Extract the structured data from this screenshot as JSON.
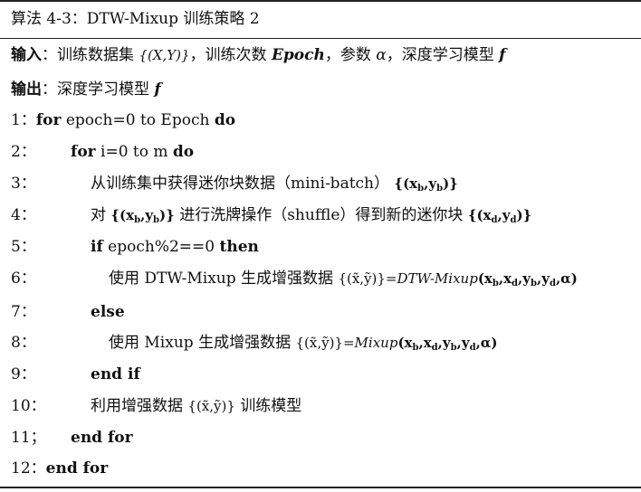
{
  "algorithm": {
    "title": "算法 4-3：DTW-Mixup 训练策略 2",
    "input": {
      "label": "输入",
      "colon": "：",
      "text1": "训练数据集",
      "dataset": "{(X,Y)}",
      "text2": "，训练次数",
      "epoch": "Epoch",
      "text3": "，参数",
      "alpha": "α",
      "text4": "，深度学习模型",
      "model": "f"
    },
    "output": {
      "label": "输出",
      "colon": "：",
      "text": "深度学习模型",
      "model": "f"
    },
    "lines": [
      {
        "num": "1：",
        "kw1": "for",
        "mid": " epoch=0 to Epoch ",
        "kw2": "do"
      },
      {
        "num": "2：",
        "kw1": "for",
        "mid": " i=0 to m ",
        "kw2": "do"
      },
      {
        "num": "3：",
        "text": "从训练集中获得迷你块数据（mini-batch）",
        "math": "{(x_b,y_b)}"
      },
      {
        "num": "4：",
        "text_a": "对",
        "math_a": "{(x_b,y_b)}",
        "text_b": "进行洗牌操作（shuffle）得到新的迷你块",
        "math_b": "{(x_d,y_d)}"
      },
      {
        "num": "5：",
        "kw1": "if",
        "mid": " epoch%2==0 ",
        "kw2": "then"
      },
      {
        "num": "6：",
        "text": "使用 DTW-Mixup 生成增强数据",
        "math_lhs": "{(x̃,ỹ)}=",
        "fn": "DTW-Mixup",
        "args": "(x_b,x_d,y_b,y_d,α)"
      },
      {
        "num": "7：",
        "kw1": "else"
      },
      {
        "num": "8：",
        "text": "使用 Mixup 生成增强数据",
        "math_lhs": "{(x̃,ỹ)}=",
        "fn": "Mixup",
        "args": "(x_b,x_d,y_b,y_d,α)"
      },
      {
        "num": "9：",
        "kw1": "end if"
      },
      {
        "num": "10：",
        "text_a": "利用增强数据",
        "math": "{(x̃,ỹ)}",
        "text_b": "训练模型"
      },
      {
        "num": "11；",
        "kw1": "end for"
      },
      {
        "num": "12：",
        "kw1": "end for"
      }
    ]
  }
}
